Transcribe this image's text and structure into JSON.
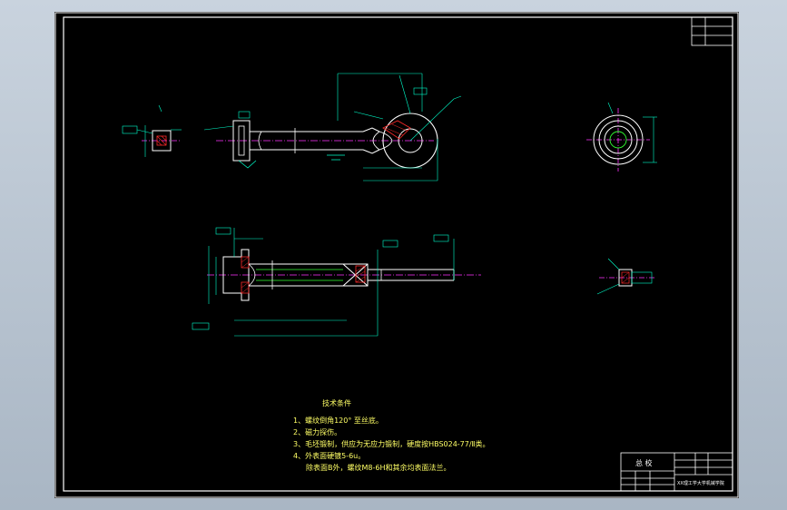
{
  "drawing": {
    "notes_title": "技术条件",
    "notes": [
      "1、螺纹倒角120° 至丝底。",
      "2、磁力探伤。",
      "3、毛坯锻制，供应为无应力锻制，硬度按HBS024-77/Ⅱ类。",
      "4、外表面硬镀5-6u。",
      "除表面B外，螺纹M8-6H和其余均表面法兰。"
    ],
    "title_block": {
      "title_label": "总 校",
      "school": "XX理工学大学机械学院"
    },
    "colors": {
      "background": "#000000",
      "outline": "#ffffff",
      "centerline": "#ff33ff",
      "dimension": "#00ffcc",
      "notes_text": "#ffff66",
      "hatch": "#ff2a2a",
      "bore": "#33ff33"
    }
  }
}
